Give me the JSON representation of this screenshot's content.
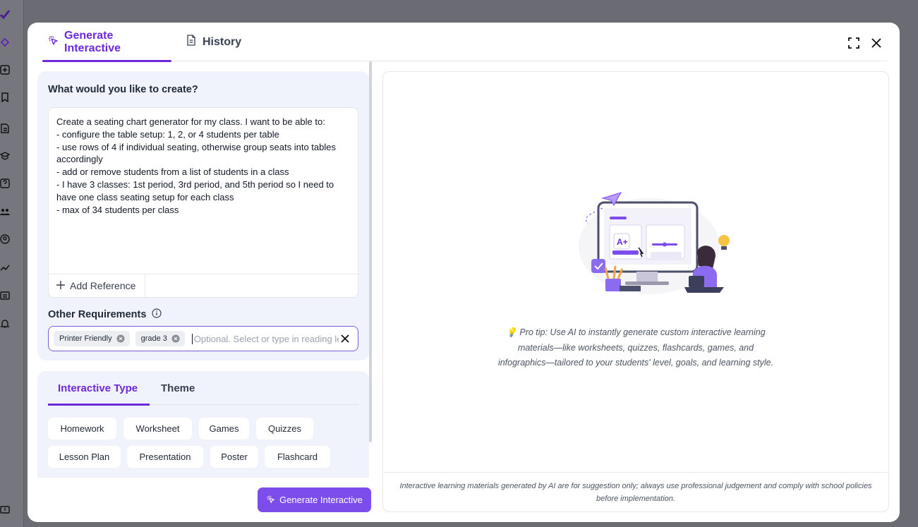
{
  "modal": {
    "tabs": [
      {
        "label": "Generate Interactive",
        "active": true
      },
      {
        "label": "History",
        "active": false
      }
    ]
  },
  "prompt": {
    "title": "What would you like to create?",
    "text": "Create a seating chart generator for my class. I want to be able to:\n- configure the table setup: 1, 2, or 4 students per table\n- use rows of 4 if individual seating, otherwise group seats into tables accordingly\n- add or remove students from a list of students in a class\n- I have 3 classes: 1st period, 3rd period, and 5th period so I need to have one class seating setup for each class\n- max of 34 students per class",
    "add_reference_label": "Add Reference"
  },
  "requirements": {
    "label": "Other Requirements",
    "chips": [
      "Printer Friendly",
      "grade 3"
    ],
    "placeholder": "Optional. Select or type in reading le"
  },
  "type_section": {
    "tabs": [
      {
        "label": "Interactive Type",
        "active": true
      },
      {
        "label": "Theme",
        "active": false
      }
    ],
    "types": [
      "Homework",
      "Worksheet",
      "Games",
      "Quizzes",
      "Lesson Plan",
      "Presentation",
      "Poster",
      "Flashcard"
    ]
  },
  "generate_button_label": "Generate Interactive",
  "right_panel": {
    "tip_emoji": "💡",
    "tip": "Pro tip: Use AI to instantly generate custom interactive learning materials—like worksheets, quizzes, flashcards, games, and infographics—tailored to your students' level, goals, and learning style.",
    "disclaimer": "Interactive learning materials generated by AI are for suggestion only; always use professional judgement and comply with school policies before implementation."
  },
  "colors": {
    "accent": "#6d28d9",
    "button": "#7c4dea",
    "panel_bg": "#f1f3fc"
  }
}
